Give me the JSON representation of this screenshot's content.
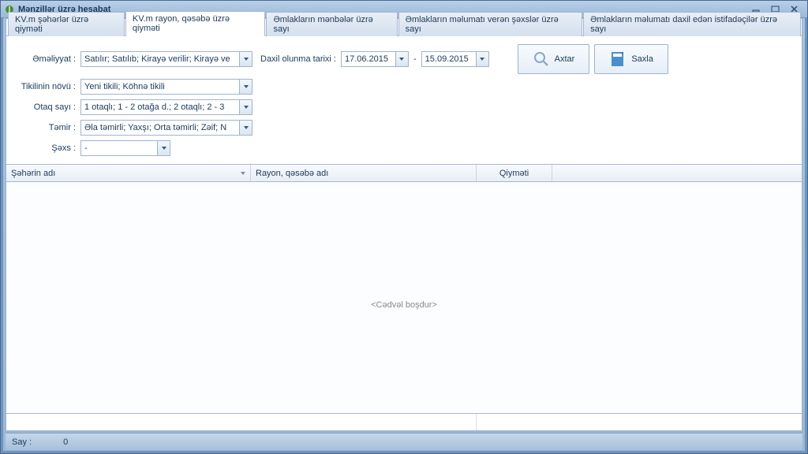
{
  "window": {
    "title": "Mənzillər üzrə hesabat"
  },
  "tabs": {
    "items": [
      "KV.m şəhərlər üzrə qiyməti",
      "KV.m rayon, qəsəbə üzrə qiyməti",
      "Əmlakların mənbələr üzrə sayı",
      "Əmlakların məlumatı verən şəxslər üzrə sayı",
      "Əmlakların məlumatı daxil edən istifadəçilər üzrə sayı"
    ],
    "active_index": 1
  },
  "filters": {
    "operation_label": "Əməliyyat :",
    "operation_value": "Satılır; Satılıb; Kirayə verilir; Kirayə ve",
    "date_label": "Daxil olunma tarixi :",
    "date_from": "17.06.2015",
    "date_to": "15.09.2015",
    "date_dash": "-",
    "building_label": "Tikilinin növü :",
    "building_value": "Yeni tikili; Köhnə tikili",
    "rooms_label": "Otaq sayı :",
    "rooms_value": "1 otaqlı; 1 - 2 otağa d.; 2 otaqlı; 2 - 3",
    "repair_label": "Təmir :",
    "repair_value": "Əla təmirli; Yaxşı; Orta təmirli; Zəif; N",
    "person_label": "Şəxs :",
    "person_value": "-"
  },
  "actions": {
    "search": "Axtar",
    "save": "Saxla"
  },
  "grid": {
    "columns": [
      "Şəhərin adı",
      "Rayon, qəsəbə adı",
      "Qiyməti"
    ],
    "empty": "<Cədvəl boşdur>"
  },
  "status": {
    "count_label": "Say :",
    "count_value": "0"
  }
}
